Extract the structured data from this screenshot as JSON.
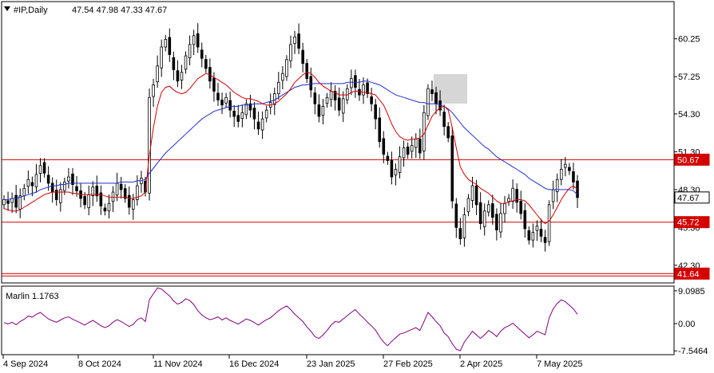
{
  "header": {
    "symbol": "#IP,Daily",
    "ohlc": "47.54 47.98 47.33 47.67"
  },
  "indicator": {
    "label": "Marlin 1.1763"
  },
  "colors": {
    "candle": "#000000",
    "ma_fast": "#d40000",
    "ma_slow": "#1f2fd0",
    "level": "#d40000",
    "oscillator": "#800080",
    "price_box": "#ffffff",
    "level_box": "#d40000"
  },
  "chart_data": [
    {
      "type": "candlestick",
      "y_ticks": [
        "60.25",
        "57.25",
        "54.30",
        "51.30",
        "48.30",
        "45.30",
        "42.30"
      ],
      "x_ticks": [
        "4 Sep 2024",
        "8 Oct 2024",
        "11 Nov 2024",
        "16 Dec 2024",
        "23 Jan 2025",
        "27 Feb 2025",
        "2 Apr 2025",
        "7 May 2025"
      ],
      "ylim": [
        40.9,
        63.2
      ],
      "current_price": "47.67",
      "current_price_value": 47.67,
      "levels": [
        {
          "label": "50.67",
          "value": 50.67
        },
        {
          "label": "45.72",
          "value": 45.72
        },
        {
          "label": "41.64",
          "value": 41.64
        }
      ],
      "closes": [
        47.5,
        47.2,
        47.6,
        46.9,
        47.8,
        48.4,
        49.1,
        48.6,
        49.5,
        50.2,
        49.6,
        48.8,
        48.1,
        47.5,
        48.3,
        48.9,
        49.3,
        48.7,
        48.2,
        47.6,
        47.1,
        47.9,
        48.5,
        47.8,
        47.0,
        46.6,
        47.2,
        48.1,
        48.8,
        48.3,
        47.6,
        46.9,
        47.5,
        48.6,
        49.2,
        48.1,
        55.6,
        56.6,
        58.1,
        59.6,
        60.2,
        59.0,
        57.8,
        56.9,
        57.6,
        58.9,
        59.8,
        60.5,
        59.6,
        58.7,
        57.9,
        56.9,
        56.1,
        55.4,
        55.0,
        55.6,
        54.6,
        54.1,
        53.7,
        54.4,
        55.1,
        54.6,
        53.9,
        53.1,
        53.9,
        54.6,
        55.2,
        55.9,
        56.8,
        57.5,
        58.6,
        59.8,
        60.4,
        59.5,
        58.3,
        57.1,
        56.2,
        55.1,
        54.1,
        54.9,
        55.6,
        56.1,
        55.4,
        54.6,
        55.5,
        56.3,
        57.1,
        56.4,
        55.8,
        56.6,
        55.9,
        55.1,
        53.9,
        52.1,
        51.1,
        50.6,
        49.3,
        49.9,
        50.9,
        51.6,
        51.1,
        51.8,
        52.3,
        51.2,
        54.4,
        56.3,
        55.9,
        55.1,
        54.6,
        53.3,
        52.4,
        47.4,
        45.3,
        44.4,
        46.3,
        47.6,
        48.6,
        47.1,
        45.6,
        46.6,
        47.1,
        46.1,
        45.1,
        46.4,
        47.2,
        47.6,
        48.4,
        47.3,
        46.4,
        45.2,
        44.3,
        44.9,
        45.4,
        44.6,
        44.1,
        47.1,
        48.3,
        49.1,
        49.9,
        50.3,
        49.8,
        48.9,
        47.67
      ],
      "ma_fast": [
        46.8,
        46.7,
        46.6,
        46.6,
        46.7,
        46.9,
        47.1,
        47.3,
        47.5,
        47.7,
        47.9,
        48.0,
        48.1,
        48.1,
        48.1,
        48.1,
        48.1,
        48.0,
        48.0,
        47.9,
        47.9,
        47.9,
        47.9,
        47.9,
        47.9,
        47.8,
        47.7,
        47.7,
        47.7,
        47.7,
        47.7,
        47.6,
        47.6,
        47.7,
        47.8,
        48.1,
        51.0,
        53.2,
        54.9,
        56.0,
        56.4,
        56.5,
        56.2,
        56.0,
        55.9,
        56.0,
        56.3,
        56.7,
        57.1,
        57.3,
        57.5,
        57.4,
        57.2,
        57.0,
        56.8,
        56.6,
        56.3,
        56.0,
        55.8,
        55.6,
        55.5,
        55.5,
        55.4,
        55.3,
        55.1,
        55.0,
        55.0,
        55.1,
        55.3,
        55.6,
        55.9,
        56.3,
        56.8,
        57.1,
        57.4,
        57.6,
        57.5,
        57.2,
        56.8,
        56.5,
        56.3,
        56.1,
        56.0,
        55.8,
        55.8,
        55.8,
        56.0,
        56.1,
        56.1,
        56.0,
        56.0,
        55.9,
        55.8,
        55.4,
        55.0,
        54.3,
        53.5,
        52.9,
        52.5,
        52.3,
        52.2,
        52.3,
        52.3,
        52.4,
        52.7,
        53.4,
        54.1,
        54.5,
        54.8,
        54.9,
        54.6,
        53.2,
        51.6,
        50.1,
        49.5,
        49.1,
        48.9,
        48.7,
        48.4,
        48.2,
        48.0,
        47.7,
        47.4,
        47.2,
        47.2,
        47.3,
        47.4,
        47.5,
        47.5,
        47.4,
        47.1,
        46.7,
        46.3,
        45.9,
        45.6,
        45.8,
        46.3,
        46.9,
        47.5,
        48.0,
        48.4,
        48.6,
        48.3
      ],
      "ma_slow": [
        47.5,
        47.5,
        47.6,
        47.6,
        47.7,
        47.8,
        47.9,
        48.0,
        48.1,
        48.3,
        48.4,
        48.5,
        48.6,
        48.6,
        48.7,
        48.7,
        48.8,
        48.8,
        48.8,
        48.8,
        48.8,
        48.8,
        48.8,
        48.8,
        48.8,
        48.8,
        48.8,
        48.8,
        48.8,
        48.9,
        48.9,
        48.9,
        48.9,
        49.0,
        49.0,
        49.1,
        49.6,
        50.0,
        50.4,
        50.8,
        51.2,
        51.5,
        51.8,
        52.1,
        52.4,
        52.7,
        53.0,
        53.3,
        53.6,
        53.9,
        54.1,
        54.3,
        54.5,
        54.6,
        54.7,
        54.8,
        54.9,
        54.9,
        54.9,
        55.0,
        55.0,
        55.0,
        55.1,
        55.1,
        55.1,
        55.2,
        55.3,
        55.4,
        55.6,
        55.8,
        56.0,
        56.2,
        56.4,
        56.5,
        56.6,
        56.6,
        56.7,
        56.7,
        56.7,
        56.7,
        56.7,
        56.7,
        56.7,
        56.7,
        56.7,
        56.8,
        56.8,
        56.8,
        56.8,
        56.9,
        56.9,
        56.8,
        56.7,
        56.6,
        56.4,
        56.2,
        56.0,
        55.8,
        55.7,
        55.6,
        55.5,
        55.4,
        55.3,
        55.2,
        55.2,
        55.1,
        55.1,
        55.1,
        55.0,
        54.9,
        54.7,
        54.4,
        54.0,
        53.6,
        53.2,
        52.9,
        52.6,
        52.3,
        52.0,
        51.7,
        51.5,
        51.2,
        50.9,
        50.7,
        50.5,
        50.3,
        50.1,
        49.9,
        49.7,
        49.5,
        49.2,
        49.0,
        48.8,
        48.6,
        48.4,
        48.3,
        48.3,
        48.3,
        48.3,
        48.3,
        48.3,
        48.2,
        47.9
      ],
      "oscillator": {
        "label": "Marlin 1.1763",
        "y_ticks": [
          "9.0985",
          "0.00",
          "-7.5464"
        ],
        "ylim": [
          -8.6,
          10.4
        ],
        "values": [
          0.3,
          -0.1,
          0.4,
          -0.3,
          0.6,
          1.2,
          2.1,
          1.8,
          2.6,
          3.1,
          2.2,
          1.3,
          0.8,
          0.4,
          1.0,
          1.6,
          1.9,
          1.2,
          0.7,
          0.2,
          -0.4,
          0.3,
          0.9,
          0.2,
          -0.6,
          -1.1,
          -0.6,
          0.4,
          1.1,
          0.6,
          -0.1,
          -0.8,
          -0.2,
          1.1,
          1.6,
          0.6,
          6.6,
          8.3,
          9.9,
          9.6,
          8.6,
          7.7,
          6.3,
          5.4,
          5.9,
          6.9,
          6.4,
          5.3,
          3.6,
          2.4,
          1.6,
          1.1,
          1.4,
          1.9,
          1.0,
          1.6,
          0.9,
          0.4,
          -0.1,
          0.6,
          1.3,
          0.9,
          0.3,
          -0.4,
          0.4,
          1.1,
          1.6,
          2.6,
          3.6,
          4.3,
          4.9,
          3.9,
          2.6,
          1.6,
          0.6,
          -0.9,
          -2.1,
          -3.6,
          -4.1,
          -3.1,
          -1.9,
          -0.4,
          0.6,
          0.4,
          1.3,
          2.2,
          3.1,
          3.9,
          2.6,
          1.6,
          0.4,
          -0.6,
          -1.8,
          -3.6,
          -5.1,
          -6.1,
          -4.9,
          -3.9,
          -2.9,
          -2.6,
          -2.1,
          -1.6,
          -1.1,
          -1.9,
          0.6,
          3.1,
          1.9,
          0.6,
          -0.6,
          -2.6,
          -3.6,
          -5.6,
          -7.1,
          -7.5,
          -5.1,
          -3.6,
          -2.1,
          -3.1,
          -4.1,
          -3.1,
          -1.9,
          -2.6,
          -3.6,
          -2.1,
          -1.1,
          -0.6,
          0.1,
          -0.9,
          -1.9,
          -2.9,
          -3.9,
          -3.1,
          -2.1,
          -2.6,
          -3.1,
          1.6,
          4.1,
          5.6,
          6.6,
          6.1,
          5.1,
          4.1,
          2.6
        ]
      }
    }
  ]
}
